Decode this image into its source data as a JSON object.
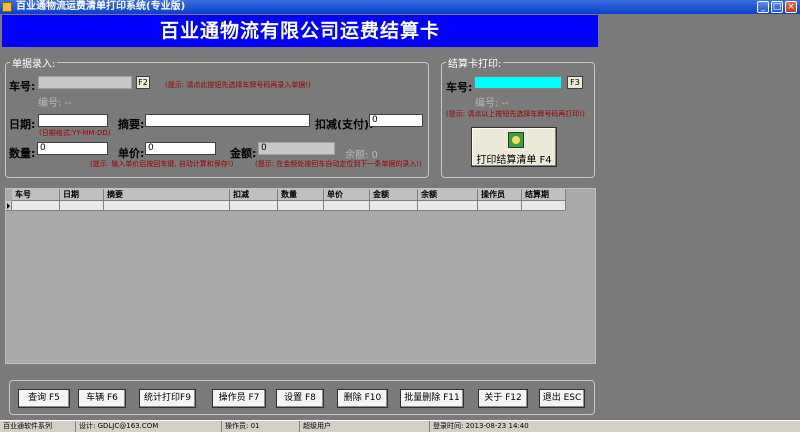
{
  "window": {
    "title": "百业通物流运费清单打印系统(专业版)",
    "minimize": "_",
    "maximize": "□",
    "close": "×"
  },
  "banner": {
    "title": "百业通物流有限公司运费结算卡"
  },
  "entry": {
    "legend": "单据录入:",
    "vehicle_label": "车号:",
    "vehicle_value": "",
    "vehicle_btn": "F2",
    "vehicle_hint": "(提示: 请点此按钮先选择车牌号码再录入单据!)",
    "code_label": "编号: --",
    "date_label": "日期:",
    "date_value": "",
    "date_hint": "(日期格式:YY-MM-DD)",
    "summary_label": "摘要:",
    "summary_value": "",
    "deduct_label": "扣减(支付):",
    "deduct_value": "0",
    "qty_label": "数量:",
    "qty_value": "0",
    "price_label": "单价:",
    "price_value": "0",
    "amount_label": "金额:",
    "amount_value": "0",
    "balance_label": "余额: 0",
    "qty_hint": "(提示: 输入单价后按回车键, 自动计算和保存!)",
    "amount_hint": "(提示: 在金额处按回车自动定位到下一条单据的录入!)"
  },
  "print_card": {
    "legend": "结算卡打印:",
    "vehicle_label": "车号:",
    "vehicle_value": "",
    "vehicle_btn": "F3",
    "code_label": "编号: --",
    "hint": "(提示: 请点以上按钮先选择车牌号码再打印!)",
    "print_btn": "打印结算清单 F4"
  },
  "table": {
    "columns": [
      "车号",
      "日期",
      "摘要",
      "扣减",
      "数量",
      "单价",
      "金额",
      "余额",
      "操作员",
      "结算期"
    ]
  },
  "toolbar": {
    "buttons": [
      "查询 F5",
      "车辆 F6",
      "统计打印F9",
      "操作员 F7",
      "设置 F8",
      "删除 F10",
      "批量删除 F11",
      "关于 F12",
      "退出 ESC"
    ]
  },
  "status": {
    "series": "百业通软件系列",
    "design": "设计: GDLJC@163.COM",
    "operator": "操作员: 01",
    "role": "超级用户",
    "login": "登录时间: 2013-08-23  14:40"
  }
}
